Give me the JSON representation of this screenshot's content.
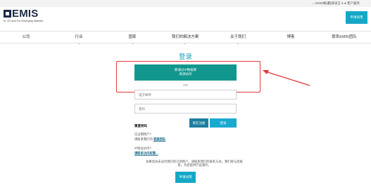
{
  "topbar": {
    "home": "EMIS概述",
    "language": "选择语言",
    "customer_service": "客户服务"
  },
  "logo": {
    "brand": "EMIS",
    "tagline": "In, On and For Emerging Markets"
  },
  "header": {
    "trial_button": "申请试用"
  },
  "nav": {
    "items": [
      {
        "label": "公司"
      },
      {
        "label": "行业"
      },
      {
        "label": "国家"
      },
      {
        "label": "我们的解决方案"
      },
      {
        "label": "关于我们"
      },
      {
        "label": "博客"
      },
      {
        "label": "联系EMIS团队"
      }
    ]
  },
  "login": {
    "title": "登录",
    "access_line1": "那通过IP数据库",
    "access_line2": "来源访问",
    "or": "OR",
    "email_placeholder": "电子邮件",
    "password_placeholder": "密码",
    "register": "现在注册",
    "submit": "登录",
    "forgot": "重置密码",
    "new_user_q": "已过期用户?",
    "new_user_text": "请联系我们的",
    "new_user_link": "客服团队",
    "ip_q": "IP地址访问?",
    "ip_link": "请联系访问权管..."
  },
  "footer": {
    "description": "如果您尚未成为我们的订阅用户，请联系我们的联系方式，我们将与您联系，为您提供产品演示。",
    "trial_button": "申请试用"
  },
  "colors": {
    "accent": "#15a8c6",
    "access_button": "#11978e",
    "highlight": "#e03a3a"
  }
}
